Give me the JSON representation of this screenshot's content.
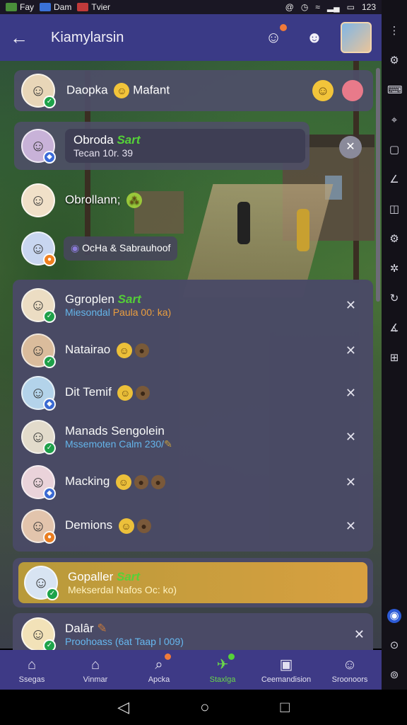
{
  "status_bar": {
    "app1": "Fay",
    "app2": "Dam",
    "app3": "Tvier",
    "time": "123",
    "icons": [
      "at-icon",
      "clock-icon",
      "wifi-icon",
      "signal-icon",
      "battery-icon"
    ]
  },
  "app_bar": {
    "back_icon": "←",
    "title": "Kiamylarsin"
  },
  "chats_top": [
    {
      "name": "Daopka",
      "name2": "Mafant",
      "status": "green"
    },
    {
      "name": "Obroda",
      "tag": "Sart",
      "sub": "Tecan 10r. 39",
      "status": "blue"
    },
    {
      "name": "Obrollann;",
      "status": "none"
    },
    {
      "name": "",
      "sub": "OcHa & Sabrauhoof",
      "status": "orange"
    }
  ],
  "chats_list": [
    {
      "name": "Ggroplen",
      "tag": "Sart",
      "sub_a": "Miesondal",
      "sub_b": "Paula 00: ka)",
      "status": "green"
    },
    {
      "name": "Natairao",
      "status": "green"
    },
    {
      "name": "Dit Temif",
      "status": "blue"
    },
    {
      "name": "Manads Sengolein",
      "sub_a": "Mssemoten Calm 230/",
      "status": "green"
    },
    {
      "name": "Macking",
      "status": "blue"
    },
    {
      "name": "Demions",
      "status": "orange"
    }
  ],
  "highlight": {
    "name": "Gopaller",
    "tag": "Sart",
    "sub": "Mekserdal Nafos Oc: ko)"
  },
  "last": {
    "name": "Dalâr",
    "sub": "Proohoass (6at Taap l 009)"
  },
  "nav": [
    {
      "label": "Ssegas",
      "icon": "home-icon"
    },
    {
      "label": "Vinmar",
      "icon": "house-icon"
    },
    {
      "label": "Apcka",
      "icon": "search-icon"
    },
    {
      "label": "Staxlga",
      "icon": "explore-icon"
    },
    {
      "label": "Ceemandision",
      "icon": "image-icon"
    },
    {
      "label": "Sroonoors",
      "icon": "profile-icon"
    }
  ],
  "colors": {
    "accent": "#3a3a86",
    "green": "#55d238",
    "highlight": "#c89a3a"
  }
}
